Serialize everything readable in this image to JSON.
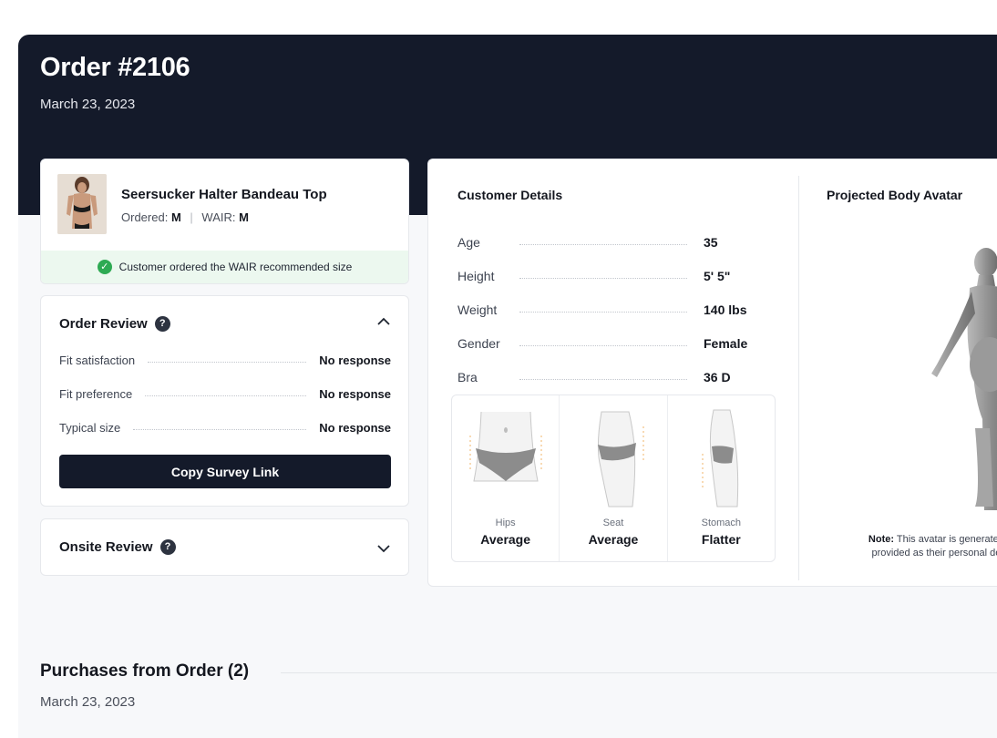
{
  "header": {
    "title": "Order #2106",
    "date": "March 23, 2023"
  },
  "product": {
    "name": "Seersucker Halter Bandeau Top",
    "ordered_label": "Ordered:",
    "ordered_size": "M",
    "separator": "|",
    "wair_label": "WAIR:",
    "wair_size": "M",
    "banner_text": "Customer ordered the WAIR recommended size"
  },
  "order_review": {
    "title": "Order Review",
    "rows": [
      {
        "label": "Fit satisfaction",
        "value": "No response"
      },
      {
        "label": "Fit preference",
        "value": "No response"
      },
      {
        "label": "Typical size",
        "value": "No response"
      }
    ],
    "button_label": "Copy Survey Link"
  },
  "onsite_review": {
    "title": "Onsite Review"
  },
  "customer_details": {
    "title": "Customer Details",
    "rows": [
      {
        "label": "Age",
        "value": "35"
      },
      {
        "label": "Height",
        "value": "5' 5\""
      },
      {
        "label": "Weight",
        "value": "140 lbs"
      },
      {
        "label": "Gender",
        "value": "Female"
      },
      {
        "label": "Bra",
        "value": "36 D"
      }
    ],
    "shapes": [
      {
        "category": "Hips",
        "value": "Average"
      },
      {
        "category": "Seat",
        "value": "Average"
      },
      {
        "category": "Stomach",
        "value": "Flatter"
      }
    ]
  },
  "avatar": {
    "title": "Projected Body Avatar",
    "note_label": "Note:",
    "note_line1": "This avatar is generated b",
    "note_line2": "provided as their personal deta"
  },
  "purchases": {
    "title": "Purchases from Order (2)",
    "date": "March 23, 2023"
  },
  "colors": {
    "header_bg": "#141a2a",
    "success_green": "#2eaa53",
    "banner_bg": "#ecf8ef",
    "button_bg": "#141a2a"
  },
  "icons": {
    "help": "help-circle-icon",
    "check": "check-circle-icon",
    "chevron_up": "chevron-up-icon",
    "chevron_down": "chevron-down-icon"
  }
}
